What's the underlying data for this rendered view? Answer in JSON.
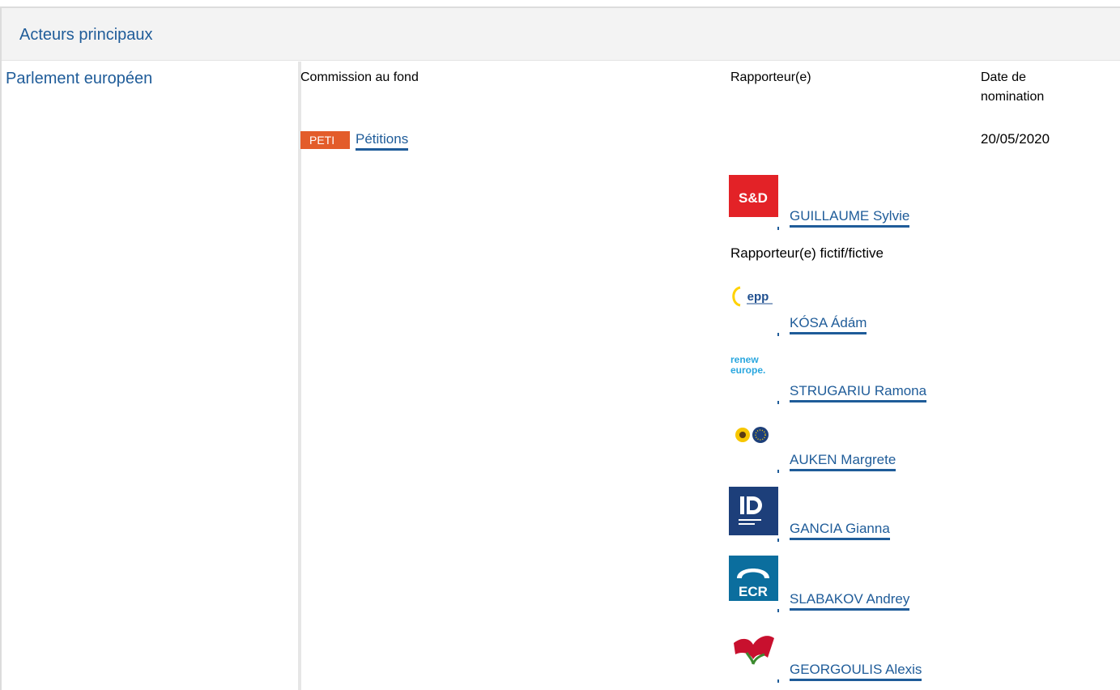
{
  "section": {
    "title": "Acteurs principaux"
  },
  "institution": "Parlement européen",
  "columns": {
    "committee": "Commission au fond",
    "rapporteur": "Rapporteur(e)",
    "date_line1": "Date de",
    "date_line2": "nomination"
  },
  "committee": {
    "code": "PETI",
    "name": "Pétitions",
    "badge_color": "#e35c2a"
  },
  "nomination_date": "20/05/2020",
  "rapporteur": {
    "name": "GUILLAUME Sylvie",
    "group_logo_text": "S&D"
  },
  "shadow_label": "Rapporteur(e) fictif/fictive",
  "shadow_rapporteurs": [
    {
      "name": "KÓSA Ádám",
      "group_logo_text": "epp",
      "logo_icon": "epp-logo-icon"
    },
    {
      "name": "STRUGARIU Ramona",
      "group_logo_line1": "renew",
      "group_logo_line2": "europe.",
      "logo_icon": "renew-europe-logo-icon"
    },
    {
      "name": "AUKEN Margrete",
      "logo_icon": "greens-efa-logo-icon"
    },
    {
      "name": "GANCIA Gianna",
      "logo_icon": "identity-democracy-logo-icon"
    },
    {
      "name": "SLABAKOV Andrey",
      "group_logo_text": "ECR",
      "logo_icon": "ecr-logo-icon"
    },
    {
      "name": "GEORGOULIS Alexis",
      "logo_icon": "left-group-logo-icon"
    }
  ],
  "colors": {
    "link": "#1f5c99",
    "header_bg": "#f3f3f3",
    "sd_red": "#e32227",
    "id_blue": "#1d3f7a",
    "ecr_blue": "#0b6e9e"
  }
}
